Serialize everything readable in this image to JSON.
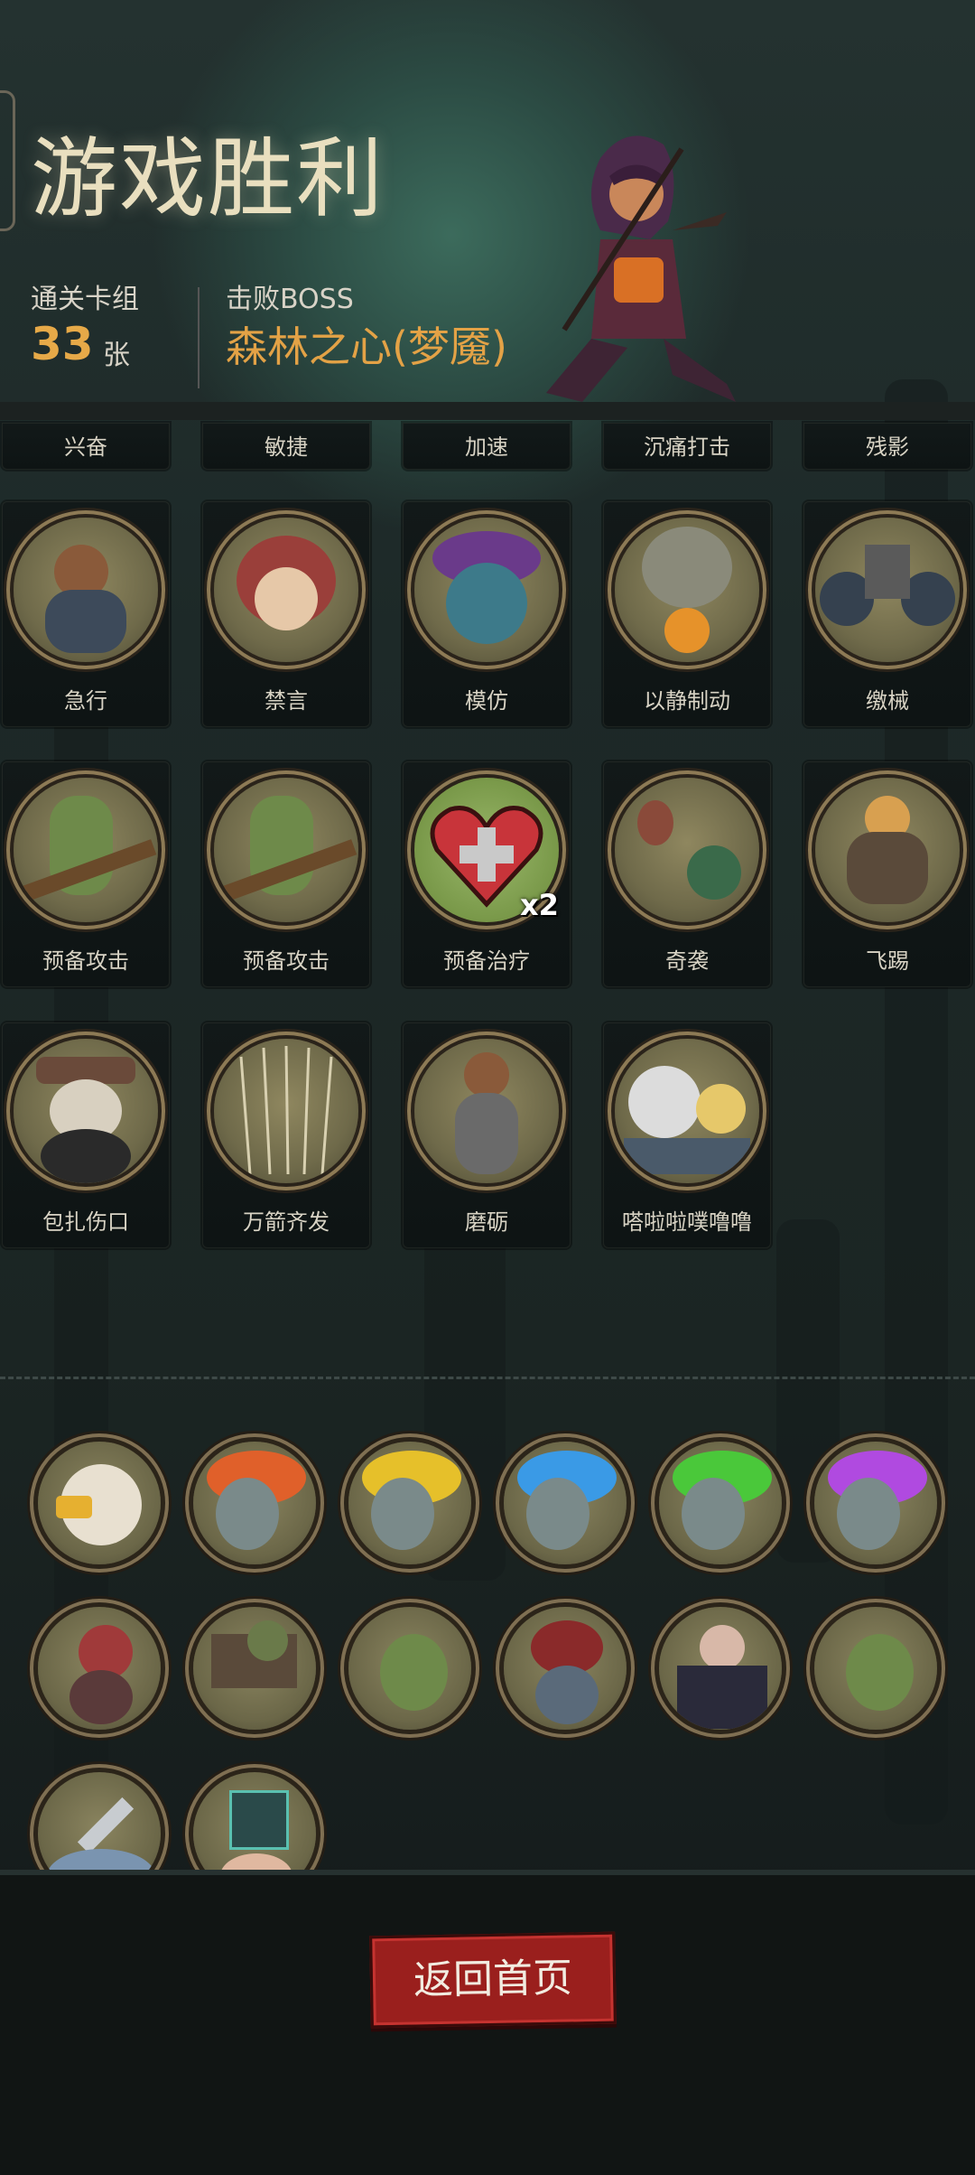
{
  "header": {
    "title": "游戏胜利",
    "deck_label": "通关卡组",
    "deck_count": "33",
    "deck_unit": "张",
    "boss_label": "击败BOSS",
    "boss_name": "森林之心(梦魇)"
  },
  "cards": {
    "row0": [
      "兴奋",
      "敏捷",
      "加速",
      "沉痛打击",
      "残影"
    ],
    "row1": [
      "急行",
      "禁言",
      "模仿",
      "以静制动",
      "缴械"
    ],
    "row2": [
      "预备攻击",
      "预备攻击",
      "预备治疗",
      "奇袭",
      "飞踢"
    ],
    "row3": [
      "包扎伤口",
      "万箭齐发",
      "磨砺",
      "嗒啦啦噗噜噜"
    ],
    "badge": "x2"
  },
  "relics": {
    "row0": [
      "eagle-relic-icon",
      "fire-skull-red-icon",
      "fire-skull-yellow-icon",
      "fire-skull-blue-icon",
      "fire-skull-green-icon",
      "fire-skull-purple-icon"
    ],
    "row1": [
      "hooded-archer-icon",
      "treasure-box-icon",
      "ghost-goblin-icon",
      "red-demon-icon",
      "vampire-icon",
      "ghost-goblin-icon"
    ],
    "row2": [
      "dagger-icon",
      "magic-hand-icon"
    ]
  },
  "actions": {
    "back_home": "返回首页"
  },
  "colors": {
    "accent_gold": "#e6a948",
    "button_red": "#9a1f1d"
  }
}
